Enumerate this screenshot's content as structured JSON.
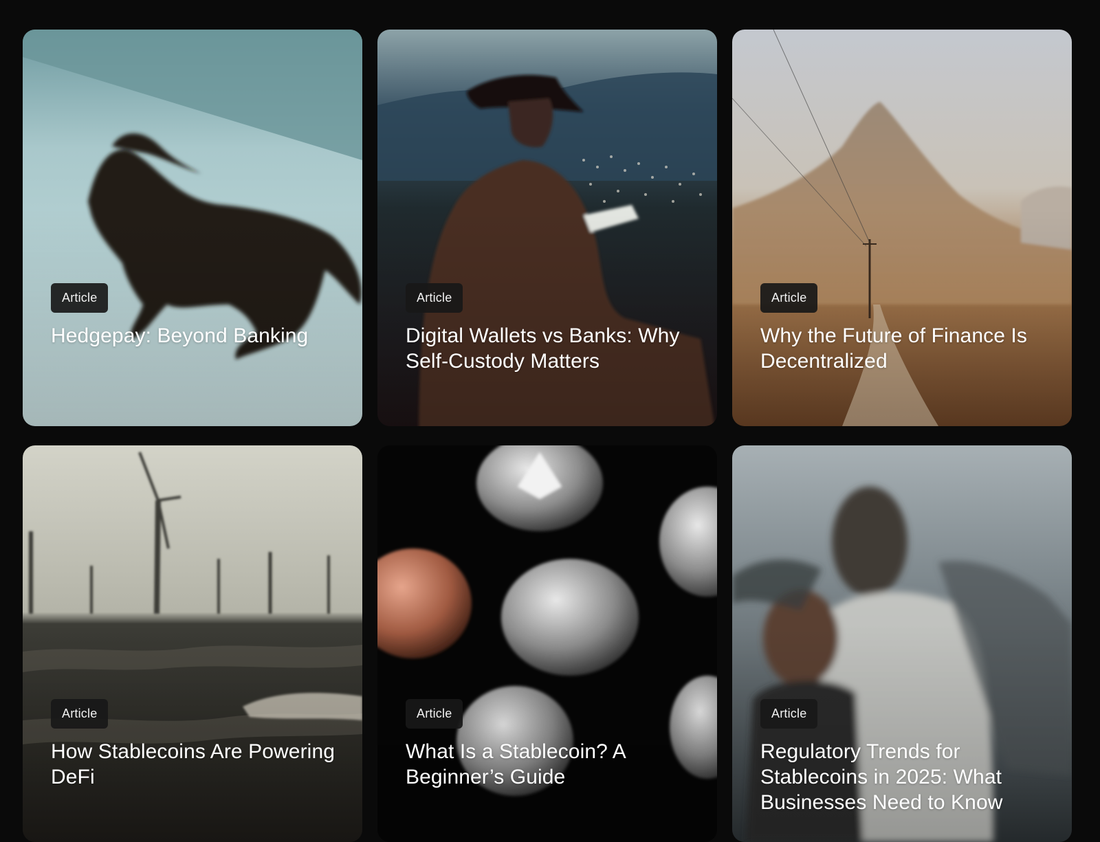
{
  "cards": [
    {
      "badge": "Article",
      "title": "Hedgepay: Beyond Banking",
      "image": "galloping-horse-snow"
    },
    {
      "badge": "Article",
      "title": "Digital Wallets vs Banks: Why Self-Custody Matters",
      "image": "cowboy-with-tablet"
    },
    {
      "badge": "Article",
      "title": "Why the Future of Finance Is Decentralized",
      "image": "desert-mountain-road"
    },
    {
      "badge": "Article",
      "title": "How Stablecoins Are Powering DeFi",
      "image": "wind-turbines-sea"
    },
    {
      "badge": "Article",
      "title": "What Is a Stablecoin? A Beginner’s Guide",
      "image": "crypto-coins"
    },
    {
      "badge": "Article",
      "title": "Regulatory Trends for Stablecoins in 2025: What Businesses Need to Know",
      "image": "people-motion-blur"
    }
  ],
  "colors": {
    "page_background": "#0a0a0a",
    "badge_background": "#181818",
    "title_text": "#ffffff"
  }
}
